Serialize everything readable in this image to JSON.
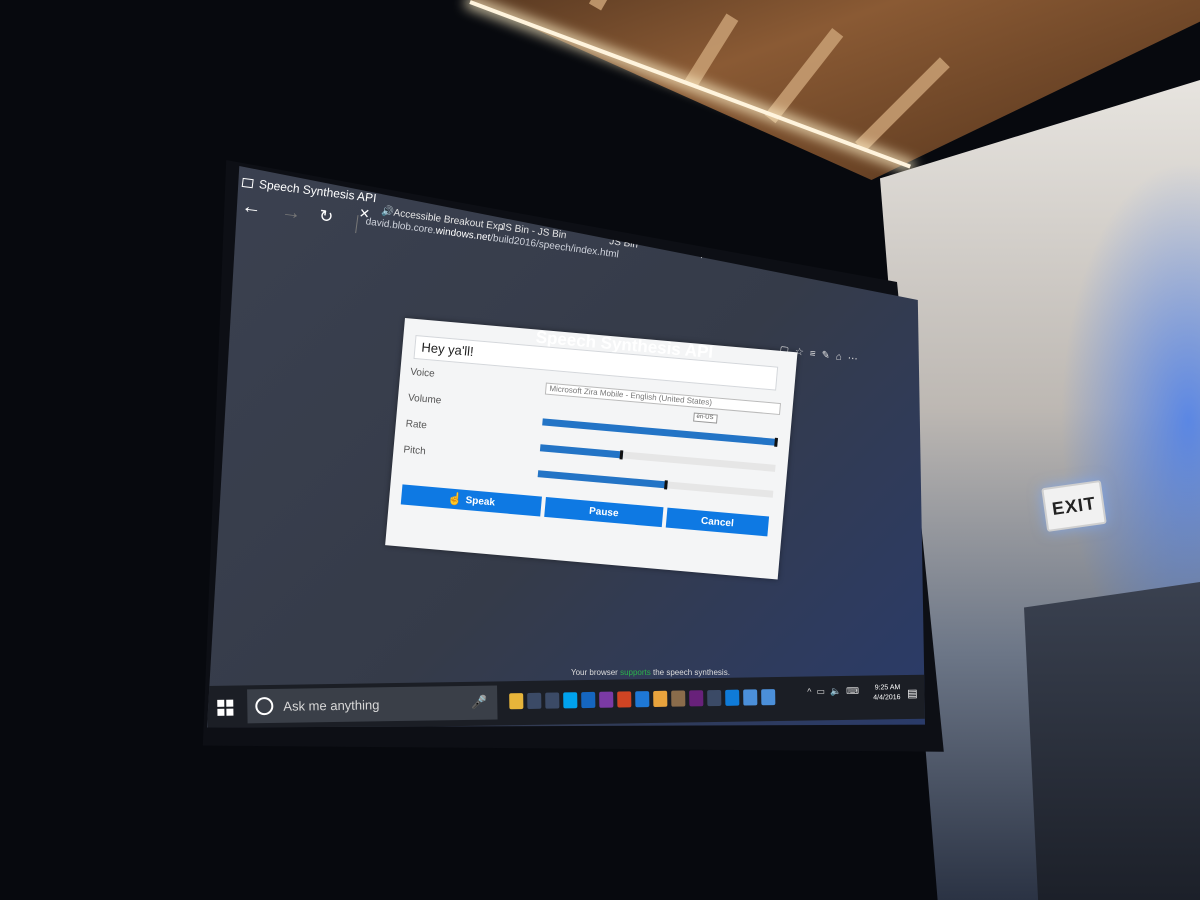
{
  "browser": {
    "active_tab_title": "Speech Synthesis API",
    "tabs": [
      "Accessible Breakout Exp",
      "JS Bin - JS Bin",
      "JS Bin"
    ],
    "new_tab_label": "+",
    "address": {
      "prefix": "david.blob.core.",
      "domain": "windows.net",
      "path": "/build2016/speech/index.html"
    },
    "nav": {
      "back": "←",
      "forward": "→",
      "refresh": "↻",
      "close_tab": "✕"
    }
  },
  "page": {
    "title": "Speech Synthesis API",
    "text_value": "Hey ya'll!",
    "labels": {
      "voice": "Voice",
      "volume": "Volume",
      "rate": "Rate",
      "pitch": "Pitch"
    },
    "voice_selected": "Microsoft Zira Mobile - English (United States)",
    "lang_selected": "en-US",
    "sliders": {
      "volume": 1.0,
      "rate": 0.35,
      "pitch": 0.55
    },
    "buttons": {
      "speak": "Speak",
      "pause": "Pause",
      "cancel": "Cancel"
    },
    "status": {
      "before": "Your browser",
      "highlight": "supports",
      "after": "the speech synthesis."
    }
  },
  "taskbar": {
    "search_placeholder": "Ask me anything",
    "time": "9:25 AM",
    "date": "4/4/2016",
    "apps": [
      {
        "icon": "file-explorer-icon",
        "color": "#e8b53a"
      },
      {
        "icon": "mail-icon",
        "color": "#3b4a66"
      },
      {
        "icon": "calendar-icon",
        "color": "#3b4a66"
      },
      {
        "icon": "skype-icon",
        "color": "#00a2ed"
      },
      {
        "icon": "outlook-icon",
        "color": "#1566c0"
      },
      {
        "icon": "onenote-icon",
        "color": "#7b3aa5"
      },
      {
        "icon": "powerpoint-icon",
        "color": "#d04423"
      },
      {
        "icon": "edge-icon",
        "color": "#1e78d6"
      },
      {
        "icon": "chrome-icon",
        "color": "#e8a33d"
      },
      {
        "icon": "app-icon",
        "color": "#8a6c4b"
      },
      {
        "icon": "visual-studio-icon",
        "color": "#68217a"
      },
      {
        "icon": "excel-icon",
        "color": "#3b4a66"
      },
      {
        "icon": "skype-business-icon",
        "color": "#0f7bd8"
      },
      {
        "icon": "documents-icon",
        "color": "#4b8fd9"
      },
      {
        "icon": "network-icon",
        "color": "#4b8fd9"
      }
    ]
  },
  "scene": {
    "exit_sign": "EXIT"
  }
}
